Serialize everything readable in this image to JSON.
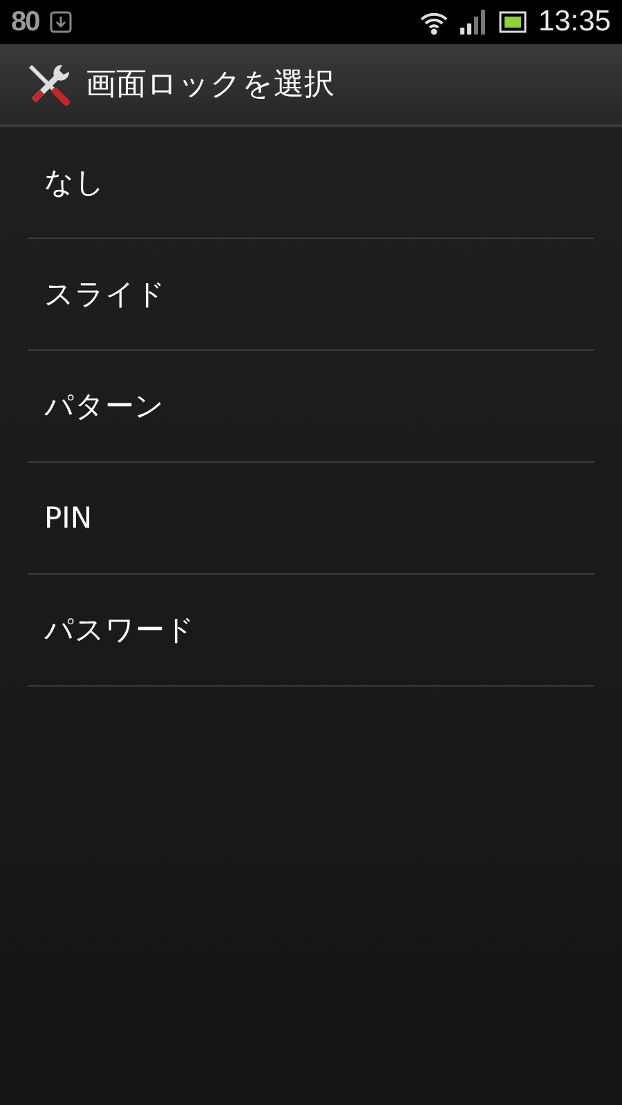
{
  "status_bar": {
    "notification_count": "80",
    "time": "13:35"
  },
  "header": {
    "title": "画面ロックを選択"
  },
  "options": [
    {
      "label": "なし"
    },
    {
      "label": "スライド"
    },
    {
      "label": "パターン"
    },
    {
      "label": "PIN"
    },
    {
      "label": "パスワード"
    }
  ]
}
